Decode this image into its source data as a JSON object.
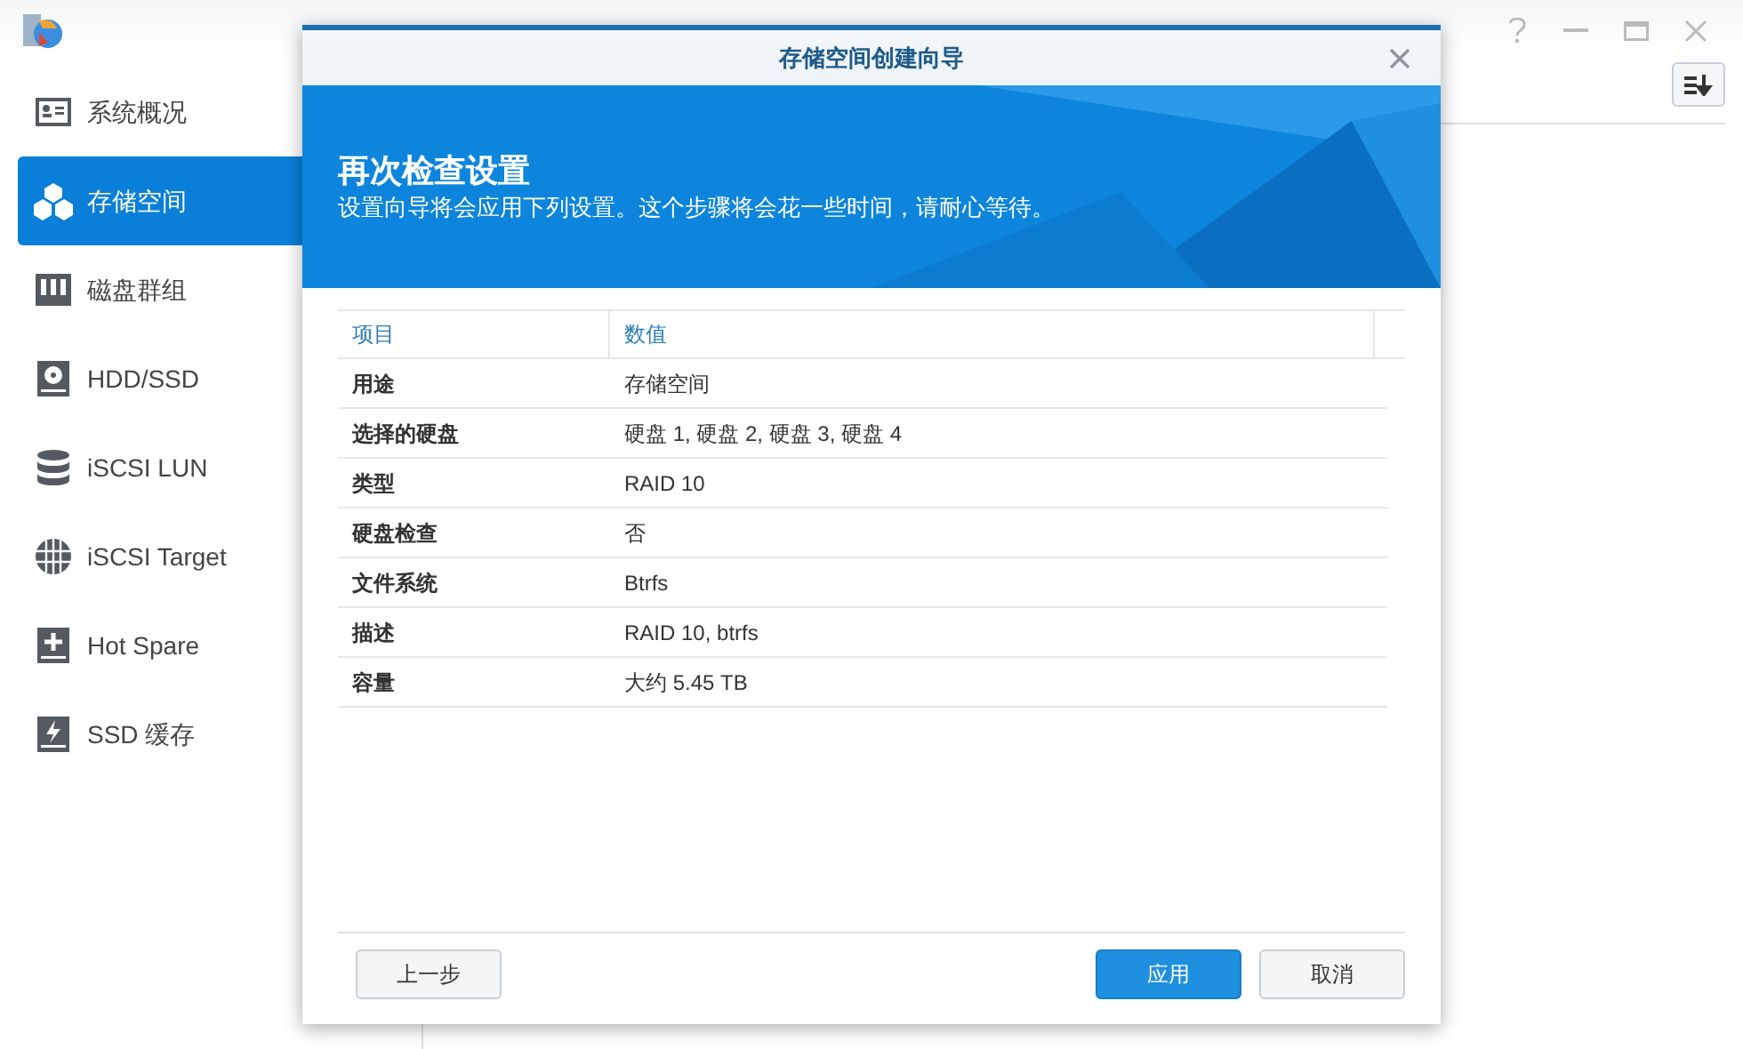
{
  "sidebar": {
    "items": [
      {
        "label": "系统概况",
        "kind": "overview",
        "selected": false
      },
      {
        "label": "存储空间",
        "kind": "cubes",
        "selected": true
      },
      {
        "label": "磁盘群组",
        "kind": "group",
        "selected": false
      },
      {
        "label": "HDD/SSD",
        "kind": "disk",
        "selected": false
      },
      {
        "label": "iSCSI LUN",
        "kind": "database",
        "selected": false
      },
      {
        "label": "iSCSI Target",
        "kind": "globe",
        "selected": false
      },
      {
        "label": "Hot Spare",
        "kind": "plus",
        "selected": false
      },
      {
        "label": "SSD 缓存",
        "kind": "bolt",
        "selected": false
      }
    ]
  },
  "dialog": {
    "title": "存储空间创建向导",
    "banner": {
      "heading": "再次检查设置",
      "description": "设置向导将会应用下列设置。这个步骤将会花一些时间，请耐心等待。"
    },
    "table": {
      "columns": [
        "项目",
        "数值"
      ],
      "rows": [
        [
          "用途",
          "存储空间"
        ],
        [
          "选择的硬盘",
          "硬盘 1, 硬盘 2, 硬盘 3, 硬盘 4"
        ],
        [
          "类型",
          "RAID 10"
        ],
        [
          "硬盘检查",
          "否"
        ],
        [
          "文件系统",
          "Btrfs"
        ],
        [
          "描述",
          "RAID 10, btrfs"
        ],
        [
          "容量",
          "大约 5.45 TB"
        ]
      ]
    },
    "buttons": [
      {
        "label": "上一步",
        "kind": "secondary"
      },
      {
        "label": "应用",
        "kind": "primary"
      },
      {
        "label": "取消",
        "kind": "secondary"
      }
    ]
  }
}
